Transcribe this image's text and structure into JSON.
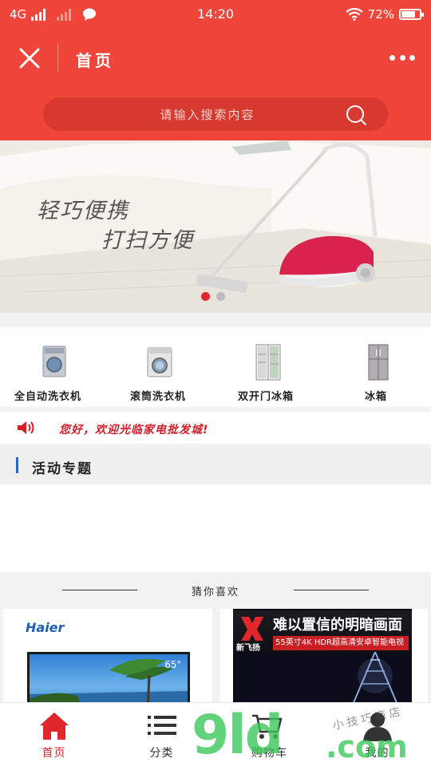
{
  "status_bar": {
    "network": "4G",
    "time": "14:20",
    "battery": "72%"
  },
  "header": {
    "title": "首页",
    "search_placeholder": "请输入搜索内容",
    "accent_color": "#f0453a"
  },
  "banner": {
    "line1": "轻巧便携",
    "line2": "打扫方便",
    "slide_count": 2,
    "active_slide": 1
  },
  "categories": [
    {
      "label": "全自动洗衣机",
      "icon": "washing-machine-icon"
    },
    {
      "label": "滚筒洗衣机",
      "icon": "drum-washer-icon"
    },
    {
      "label": "双开门冰箱",
      "icon": "double-door-fridge-icon"
    },
    {
      "label": "冰箱",
      "icon": "fridge-icon"
    }
  ],
  "notice": {
    "text": "您好，欢迎光临家电批发城!",
    "icon": "speaker-icon"
  },
  "section": {
    "title": "活动专题"
  },
  "recommend": {
    "title": "猜你喜欢",
    "products": [
      {
        "brand": "Haier",
        "size": "65\""
      },
      {
        "brand": "新飞扬",
        "headline": "难以置信的明暗画面",
        "subline": "55英寸4K HDR超高清安卓智能电视"
      }
    ]
  },
  "tabbar": {
    "items": [
      {
        "label": "首页",
        "icon": "home-icon"
      },
      {
        "label": "分类",
        "icon": "list-icon"
      },
      {
        "label": "购物车",
        "icon": "cart-icon"
      },
      {
        "label": "我的",
        "icon": "user-icon"
      }
    ]
  },
  "watermark": {
    "big": "9ld",
    "com": ".com",
    "small": "小技巧商店"
  }
}
